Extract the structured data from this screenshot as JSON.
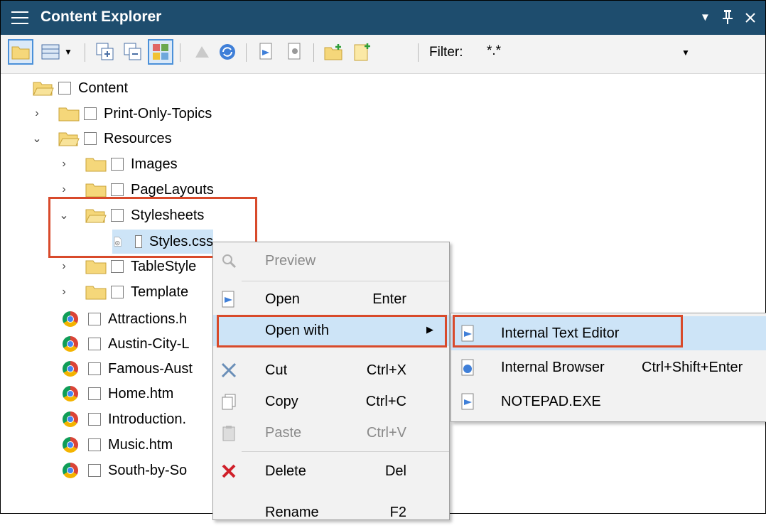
{
  "window": {
    "title": "Content Explorer",
    "menu_icon": "hamburger-icon",
    "controls": [
      "dropdown-arrow-icon",
      "pin-icon",
      "close-icon"
    ]
  },
  "toolbar": {
    "filter_label": "Filter:",
    "filter_value": "*.*"
  },
  "tree": {
    "items": [
      {
        "label": "Content"
      },
      {
        "label": "Print-Only-Topics"
      },
      {
        "label": "Resources"
      },
      {
        "label": "Images"
      },
      {
        "label": "PageLayouts"
      },
      {
        "label": "Stylesheets"
      },
      {
        "label": "Styles.css"
      },
      {
        "label": "TableStyle"
      },
      {
        "label": "Template"
      },
      {
        "label": "Attractions.h"
      },
      {
        "label": "Austin-City-L"
      },
      {
        "label": "Famous-Aust"
      },
      {
        "label": "Home.htm"
      },
      {
        "label": "Introduction."
      },
      {
        "label": "Music.htm"
      },
      {
        "label": "South-by-So"
      }
    ]
  },
  "context_menu": {
    "items": [
      {
        "label": "Preview",
        "shortcut": ""
      },
      {
        "label": "Open",
        "shortcut": "Enter"
      },
      {
        "label": "Open with",
        "shortcut": ""
      },
      {
        "label": "Cut",
        "shortcut": "Ctrl+X"
      },
      {
        "label": "Copy",
        "shortcut": "Ctrl+C"
      },
      {
        "label": "Paste",
        "shortcut": "Ctrl+V"
      },
      {
        "label": "Delete",
        "shortcut": "Del"
      },
      {
        "label": "Rename",
        "shortcut": "F2"
      }
    ]
  },
  "submenu": {
    "items": [
      {
        "label": "Internal Text Editor",
        "shortcut": ""
      },
      {
        "label": "Internal Browser",
        "shortcut": "Ctrl+Shift+Enter"
      },
      {
        "label": "NOTEPAD.EXE",
        "shortcut": ""
      }
    ]
  },
  "colors": {
    "titlebar": "#1e4d6e",
    "highlight": "#cde4f7",
    "callout": "#d84a2b"
  }
}
